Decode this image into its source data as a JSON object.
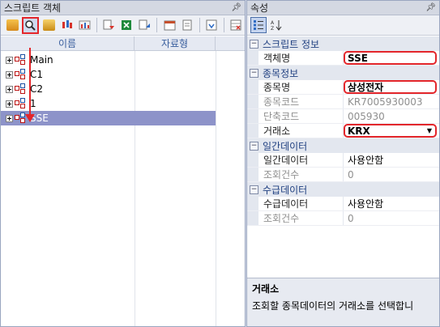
{
  "left_panel": {
    "title": "스크립트 객체",
    "columns": [
      "이름",
      "자료형"
    ],
    "toolbar_icons": [
      "edit-icon",
      "search-icon",
      "layers-icon",
      "candle-chart-icon",
      "chart-export-icon",
      "import-icon",
      "excel-icon",
      "export-icon",
      "calendar-icon",
      "document-icon",
      "download-icon",
      "table-icon"
    ],
    "tree_items": [
      {
        "name": "Main",
        "type": ""
      },
      {
        "name": "C1",
        "type": ""
      },
      {
        "name": "C2",
        "type": ""
      },
      {
        "name": "1",
        "type": ""
      },
      {
        "name": "SSE",
        "type": ""
      }
    ]
  },
  "right_panel": {
    "title": "속성",
    "categories": [
      {
        "label": "스크립트 정보",
        "props": [
          {
            "name": "객체명",
            "value": "SSE"
          }
        ]
      },
      {
        "label": "종목정보",
        "props": [
          {
            "name": "종목명",
            "value": "삼성전자"
          },
          {
            "name": "종목코드",
            "value": "KR7005930003"
          },
          {
            "name": "단축코드",
            "value": "005930"
          },
          {
            "name": "거래소",
            "value": "KRX"
          }
        ]
      },
      {
        "label": "일간데이터",
        "props": [
          {
            "name": "일간데이터",
            "value": "사용안함"
          },
          {
            "name": "조회건수",
            "value": "0"
          }
        ]
      },
      {
        "label": "수급데이터",
        "props": [
          {
            "name": "수급데이터",
            "value": "사용안함"
          },
          {
            "name": "조회건수",
            "value": "0"
          }
        ]
      }
    ],
    "description": {
      "title": "거래소",
      "text": "조회할 종목데이터의 거래소를 선택합니"
    }
  },
  "pin_glyph": "ᵖ",
  "colors": {
    "highlight": "#e3262b",
    "selection": "#8d93c9",
    "category_text": "#1f3f80"
  }
}
